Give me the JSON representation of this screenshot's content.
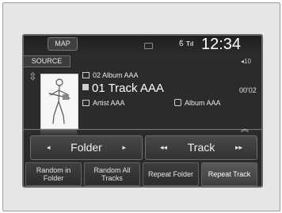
{
  "header": {
    "map_label": "MAP",
    "clock": "12:34",
    "signal_text": "Tıl"
  },
  "source_label": "SOURCE",
  "volume_indicator": "◂10",
  "now_playing": {
    "album_top": "02 Album AAA",
    "track": "01 Track AAA",
    "elapsed": "00'02",
    "artist": "Artist AAA",
    "album": "Album AAA"
  },
  "controls": {
    "folder": {
      "label": "Folder",
      "prev": "◂",
      "next": "▸"
    },
    "track": {
      "label": "Track",
      "prev": "◂◂",
      "next": "▸▸"
    }
  },
  "bottom_buttons": [
    {
      "label": "Random in Folder"
    },
    {
      "label": "Random All Tracks"
    },
    {
      "label": "Repeat Folder"
    },
    {
      "label": "Repeat Track"
    }
  ],
  "icons": {
    "usb": "usb-icon",
    "bluetooth": "bluetooth-icon",
    "battery": "battery-icon",
    "album": "album-icon",
    "track": "track-icon",
    "artist": "artist-icon"
  }
}
